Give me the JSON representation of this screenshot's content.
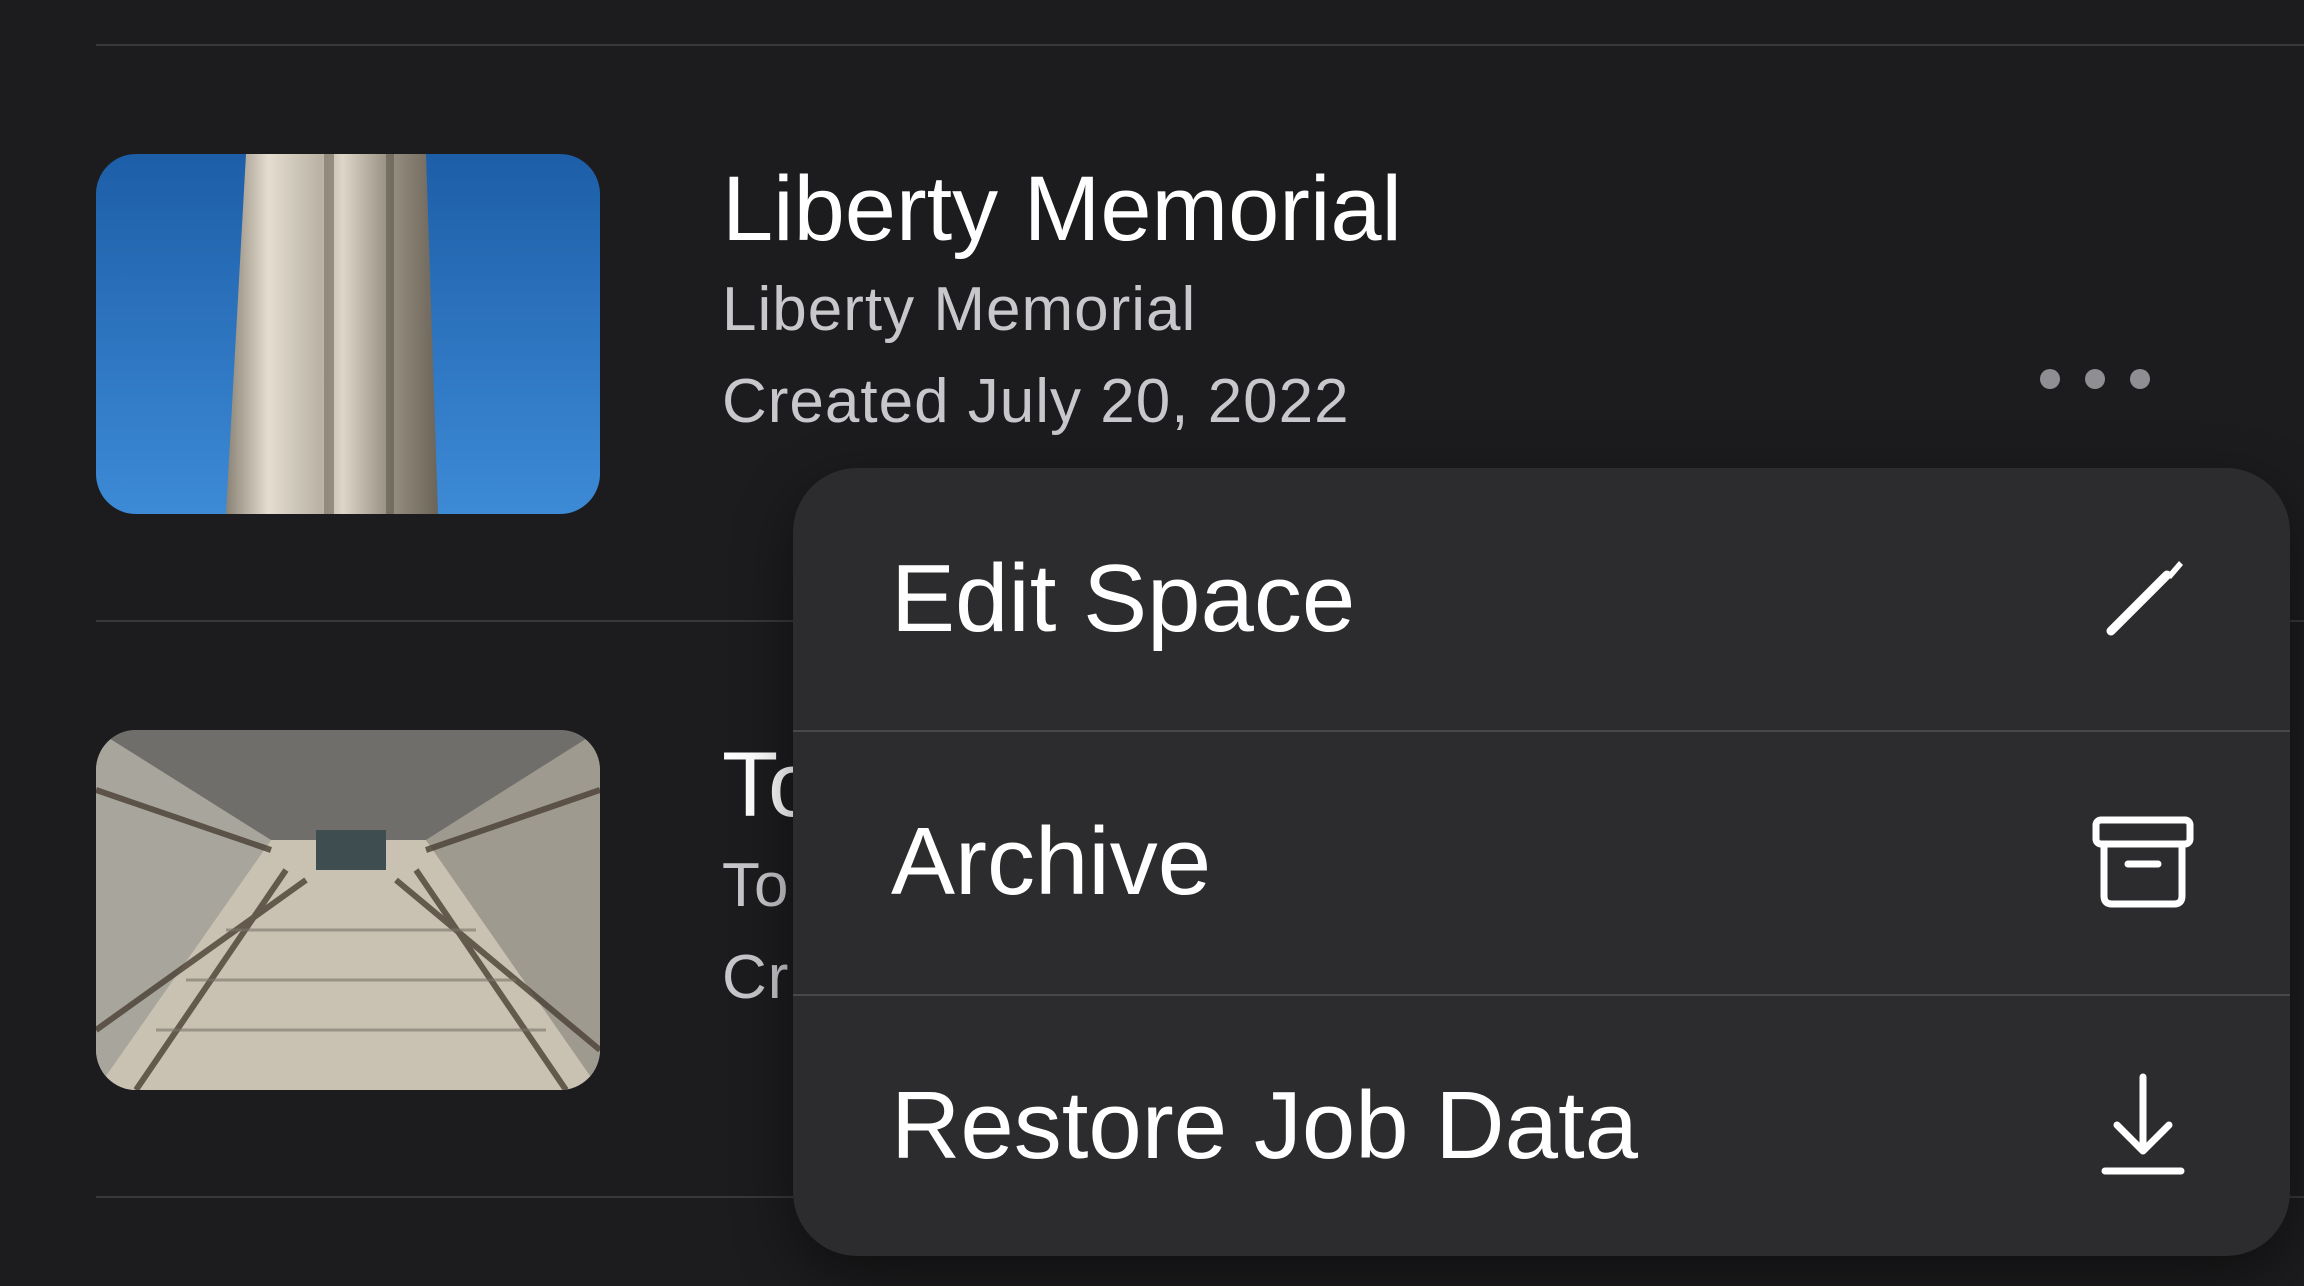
{
  "spaces": [
    {
      "title": "Liberty Memorial",
      "subtitle": "Liberty Memorial",
      "created": "Created July 20, 2022",
      "thumbnail_icon": "tower-photo"
    },
    {
      "title": "To",
      "subtitle": "To",
      "created": "Cr",
      "thumbnail_icon": "walkway-photo"
    }
  ],
  "more_button": {
    "icon": "ellipsis-icon"
  },
  "context_menu": {
    "items": [
      {
        "label": "Edit Space",
        "icon": "pencil-icon"
      },
      {
        "label": "Archive",
        "icon": "archive-box-icon"
      },
      {
        "label": "Restore Job Data",
        "icon": "download-arrow-icon"
      }
    ]
  },
  "colors": {
    "background": "#1c1c1e",
    "menu_background": "#2c2c2e",
    "divider": "#38383a",
    "secondary_text": "#c7c7cc",
    "icon_gray": "#8e8e93"
  }
}
